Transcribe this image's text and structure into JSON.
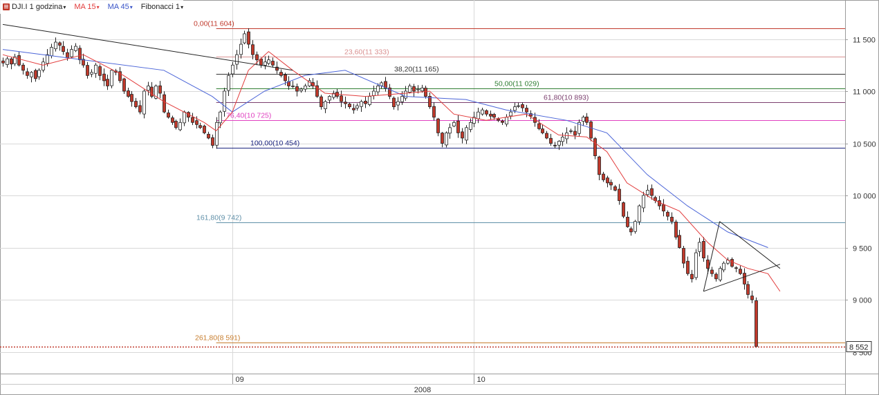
{
  "toolbar": {
    "symbol": "DJI.I 1 godzina",
    "ma15": "MA 15",
    "ma45": "MA 45",
    "fibo": "Fibonacci 1"
  },
  "colors": {
    "up_candle": "#ffffff",
    "down_candle": "#c0392b",
    "ma15": "#e23b3b",
    "ma45": "#4a64d8",
    "grid": "#d8d8d8",
    "price_line": "#c0392b"
  },
  "chart_data": {
    "type": "candlestick",
    "title": "",
    "xlabel": "",
    "ylabel": "",
    "ylim": [
      8380,
      11700
    ],
    "y_ticks": [
      9000,
      9500,
      10000,
      10500,
      11000,
      11500
    ],
    "y_tick_labels": [
      "9 000",
      "9 500",
      "10 000",
      "10 500",
      "11 000",
      "11 500"
    ],
    "x_labels": [
      {
        "label": "09",
        "bar": 57
      },
      {
        "label": "10",
        "bar": 117
      }
    ],
    "year_label": "2008",
    "last_price": 8552,
    "last_price_label": "8 552",
    "bottom_partial_label": "8 500",
    "fib_levels": [
      {
        "label": "0,00(11 604)",
        "value": 11604,
        "color": "#c0392b"
      },
      {
        "label": "23,60(11 333)",
        "value": 11333,
        "color": "#d99090"
      },
      {
        "label": "38,20(11 165)",
        "value": 11165,
        "color": "#333333"
      },
      {
        "label": "50,00(11 029)",
        "value": 11029,
        "color": "#2e7d32"
      },
      {
        "label": "61,80(10 893)",
        "value": 10893,
        "color": "#7b3f6e"
      },
      {
        "label": "76,40(10 725)",
        "value": 10725,
        "color": "#e040c0"
      },
      {
        "label": "100,00(10 454)",
        "value": 10454,
        "color": "#1a237e"
      },
      {
        "label": "161,80(9 742)",
        "value": 9742,
        "color": "#5f8fa8"
      },
      {
        "label": "261,80(8 591)",
        "value": 8591,
        "color": "#c77d2e"
      }
    ],
    "closes": [
      11270,
      11310,
      11260,
      11330,
      11250,
      11200,
      11150,
      11180,
      11120,
      11200,
      11280,
      11350,
      11420,
      11470,
      11440,
      11380,
      11320,
      11400,
      11430,
      11300,
      11250,
      11150,
      11180,
      11250,
      11150,
      11100,
      11050,
      11200,
      11180,
      11100,
      11000,
      10950,
      10900,
      10850,
      10800,
      11000,
      11050,
      10950,
      11050,
      10980,
      10800,
      10750,
      10700,
      10650,
      10700,
      10800,
      10750,
      10700,
      10680,
      10650,
      10600,
      10550,
      10480,
      10700,
      10800,
      11000,
      11150,
      11250,
      11350,
      11450,
      11550,
      11450,
      11350,
      11300,
      11250,
      11280,
      11300,
      11250,
      11200,
      11150,
      11100,
      11050,
      11050,
      11000,
      11020,
      11050,
      11100,
      11050,
      10950,
      10850,
      10900,
      10950,
      10980,
      10950,
      10900,
      10880,
      10850,
      10820,
      10860,
      10900,
      10880,
      10950,
      11000,
      11050,
      11080,
      11030,
      10950,
      10850,
      10900,
      10950,
      11000,
      11050,
      11000,
      11020,
      11030,
      10950,
      10850,
      10750,
      10600,
      10500,
      10600,
      10650,
      10700,
      10600,
      10550,
      10650,
      10700,
      10750,
      10800,
      10820,
      10780,
      10760,
      10750,
      10720,
      10700,
      10750,
      10800,
      10850,
      10860,
      10840,
      10800,
      10760,
      10700,
      10640,
      10600,
      10550,
      10500,
      10480,
      10520,
      10560,
      10600,
      10620,
      10580,
      10700,
      10750,
      10700,
      10550,
      10380,
      10200,
      10150,
      10120,
      10100,
      10050,
      9950,
      9800,
      9700,
      9650,
      9750,
      9900,
      10000,
      10050,
      10000,
      9950,
      9900,
      9850,
      9800,
      9750,
      9600,
      9500,
      9350,
      9250,
      9200,
      9450,
      9550,
      9400,
      9300,
      9250,
      9200,
      9300,
      9350,
      9380,
      9320,
      9300,
      9250,
      9150,
      9050,
      9000,
      8552
    ],
    "ma15": [
      [
        0,
        11350
      ],
      [
        10,
        11250
      ],
      [
        20,
        11350
      ],
      [
        30,
        11150
      ],
      [
        40,
        10900
      ],
      [
        50,
        10700
      ],
      [
        53,
        10620
      ],
      [
        57,
        10800
      ],
      [
        61,
        11200
      ],
      [
        66,
        11380
      ],
      [
        72,
        11200
      ],
      [
        80,
        10980
      ],
      [
        90,
        10950
      ],
      [
        100,
        10980
      ],
      [
        106,
        11000
      ],
      [
        112,
        10780
      ],
      [
        120,
        10720
      ],
      [
        130,
        10780
      ],
      [
        138,
        10580
      ],
      [
        145,
        10560
      ],
      [
        150,
        10420
      ],
      [
        155,
        10120
      ],
      [
        162,
        9950
      ],
      [
        168,
        9850
      ],
      [
        175,
        9550
      ],
      [
        180,
        9380
      ],
      [
        185,
        9300
      ],
      [
        190,
        9250
      ],
      [
        193,
        9080
      ]
    ],
    "ma45": [
      [
        0,
        11400
      ],
      [
        20,
        11300
      ],
      [
        40,
        11200
      ],
      [
        52,
        10950
      ],
      [
        57,
        10800
      ],
      [
        65,
        11000
      ],
      [
        75,
        11150
      ],
      [
        85,
        11200
      ],
      [
        100,
        10950
      ],
      [
        115,
        10920
      ],
      [
        125,
        10820
      ],
      [
        140,
        10720
      ],
      [
        150,
        10600
      ],
      [
        160,
        10200
      ],
      [
        170,
        9900
      ],
      [
        180,
        9650
      ],
      [
        190,
        9500
      ]
    ],
    "trendlines": [
      {
        "from": [
          0,
          11640
        ],
        "to": [
          72,
          11200
        ]
      },
      {
        "from": [
          174,
          9080
        ],
        "to": [
          193,
          9340
        ]
      },
      {
        "from": [
          174,
          9080
        ],
        "to": [
          178,
          9750
        ]
      },
      {
        "from": [
          178,
          9750
        ],
        "to": [
          193,
          9300
        ]
      }
    ]
  }
}
